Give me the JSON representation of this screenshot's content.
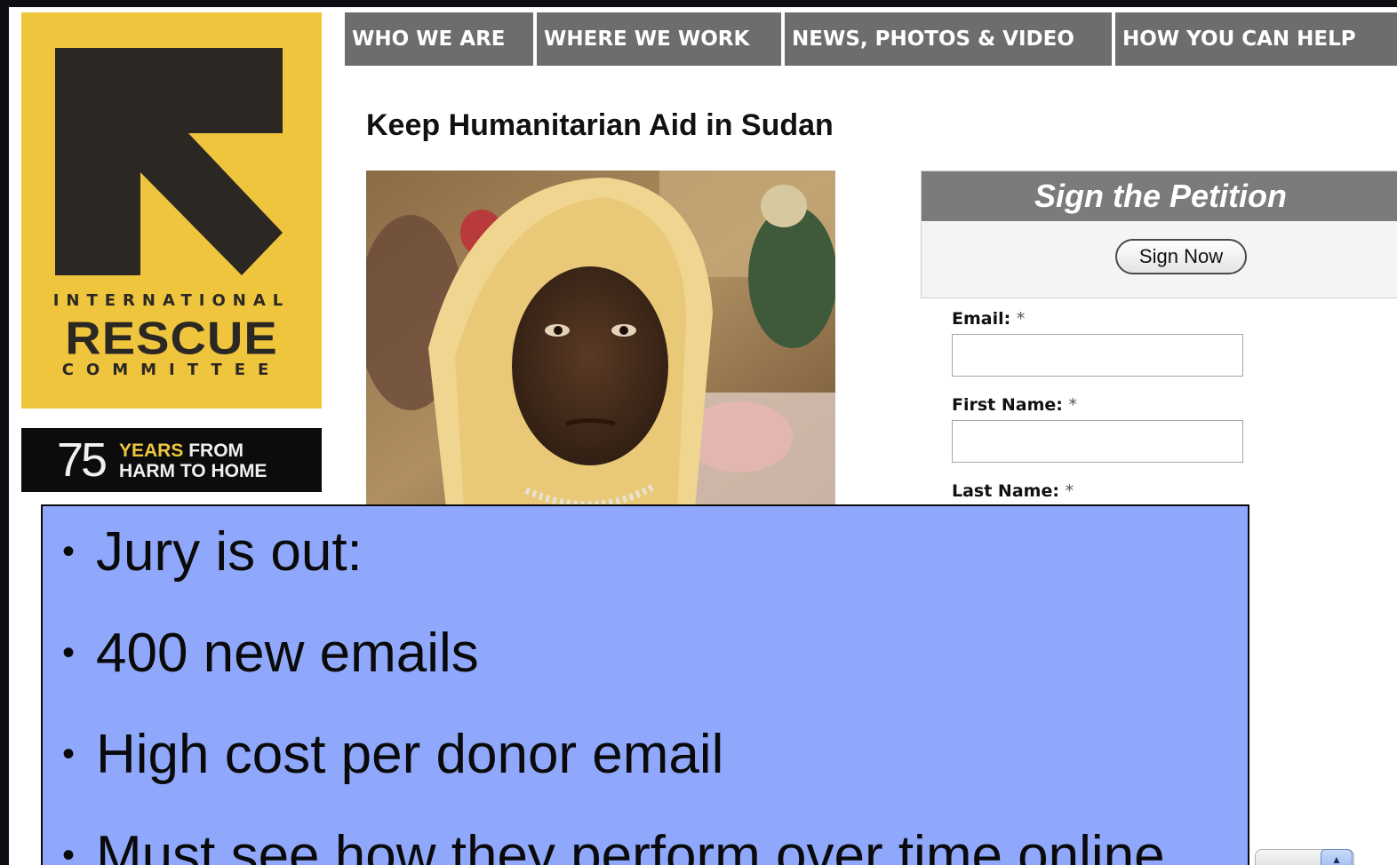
{
  "logo": {
    "line1": "INTERNATIONAL",
    "line2": "RESCUE",
    "line3": "COMMITTEE",
    "brand_color": "#f0c53e",
    "icon": "arrow-up-left-icon"
  },
  "anniversary": {
    "number": "75",
    "years": "YEARS",
    "from": "FROM",
    "line2": "HARM TO HOME"
  },
  "nav": {
    "items": [
      {
        "label": "WHO WE ARE"
      },
      {
        "label": "WHERE WE WORK"
      },
      {
        "label": "NEWS, PHOTOS & VIDEO"
      },
      {
        "label": "HOW YOU CAN HELP"
      }
    ]
  },
  "main": {
    "title": "Keep Humanitarian Aid in Sudan"
  },
  "petition": {
    "heading": "Sign the Petition",
    "button_label": "Sign Now",
    "fields": [
      {
        "label": "Email:",
        "required_mark": "*",
        "value": ""
      },
      {
        "label": "First Name:",
        "required_mark": "*",
        "value": ""
      },
      {
        "label": "Last Name:",
        "required_mark": "*",
        "value": ""
      }
    ]
  },
  "slide_overlay": {
    "bullets": [
      "Jury is out:",
      "400 new emails",
      "High cost per donor email",
      "Must see how they perform over time online"
    ],
    "background": "#8fa8fb"
  },
  "colors": {
    "slide_background": "#1c24c8",
    "nav_background": "#6d6d6d",
    "petition_header": "#7b7b7b"
  }
}
